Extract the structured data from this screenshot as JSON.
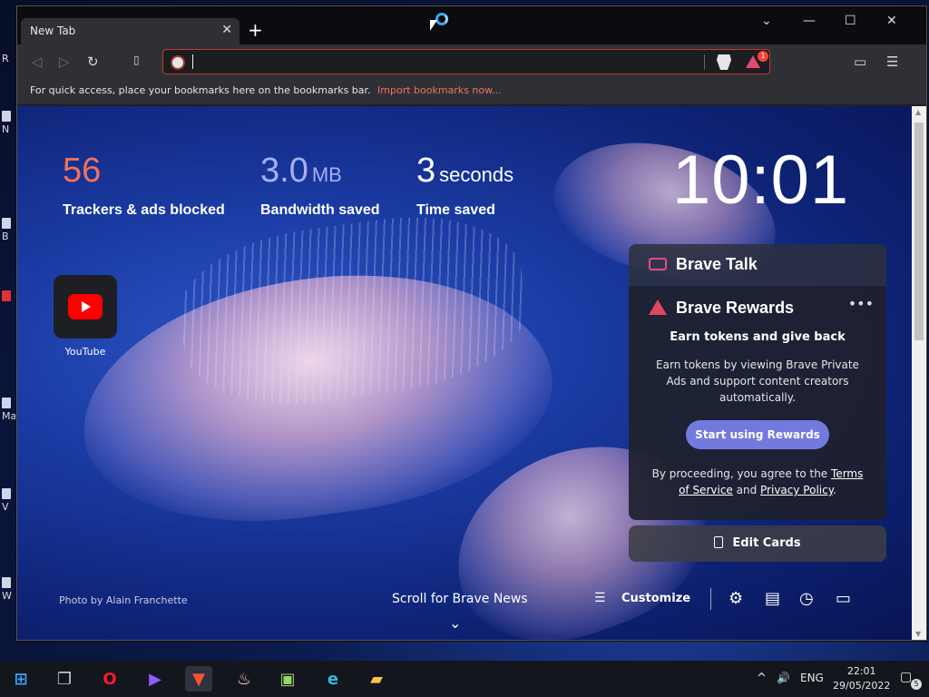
{
  "desktop": {
    "icons": [
      "R",
      "N",
      "B",
      "",
      "Ma",
      "V",
      "W"
    ]
  },
  "tab": {
    "title": "New Tab",
    "close": "✕",
    "new": "+"
  },
  "window_controls": {
    "chevron": "⌄",
    "minimize": "—",
    "maximize": "☐",
    "close": "✕"
  },
  "toolbar": {
    "back": "◁",
    "forward": "▷",
    "reload": "↻",
    "bookmark": "🔖",
    "address_value": "",
    "rewards_badge": "1",
    "wallet": "▭",
    "menu": "☰"
  },
  "bookmarks_bar": {
    "message": "For quick access, place your bookmarks here on the bookmarks bar.",
    "import_link": "Import bookmarks now..."
  },
  "stats": {
    "trackers": {
      "value": "56",
      "label": "Trackers & ads blocked",
      "color": "#f0715e"
    },
    "bandwidth": {
      "value": "3.0",
      "unit": "MB",
      "label": "Bandwidth saved",
      "color": "#a8aef5"
    },
    "time": {
      "value": "3",
      "unit": "seconds",
      "label": "Time saved",
      "color": "#ffffff"
    }
  },
  "clock": "10:01",
  "top_sites": [
    {
      "label": "YouTube",
      "icon": "youtube-icon"
    }
  ],
  "cards": {
    "talk_title": "Brave Talk",
    "rewards": {
      "title": "Brave Rewards",
      "more": "•••",
      "subtitle": "Earn tokens and give back",
      "description": "Earn tokens by viewing Brave Private Ads and support content creators automatically.",
      "button": "Start using Rewards",
      "terms_prefix": "By proceeding, you agree to the",
      "terms_link": "Terms of Service",
      "terms_and": "and",
      "privacy_link": "Privacy Policy",
      "terms_suffix": "."
    },
    "edit_cards": "Edit Cards"
  },
  "footer": {
    "photo_credit": "Photo by Alain Franchette",
    "scroll_news": "Scroll for Brave News",
    "chevron": "⌄",
    "customize": "Customize",
    "customize_icon": "☰",
    "settings_icon": "⚙",
    "bookmarks_icon": "▤",
    "history_icon": "◷",
    "talk_icon": "▭"
  },
  "taskbar": {
    "apps": [
      {
        "name": "windows-start",
        "glyph": "⊞",
        "color": "#3aa0f0"
      },
      {
        "name": "task-view",
        "glyph": "❐",
        "color": "#cfcfcf"
      },
      {
        "name": "opera",
        "glyph": "O",
        "color": "#ff1b2d"
      },
      {
        "name": "media-player",
        "glyph": "▶",
        "color": "#8b5cf6"
      },
      {
        "name": "brave",
        "glyph": "▼",
        "color": "#fb542b"
      },
      {
        "name": "popcorn",
        "glyph": "♨",
        "color": "#ffd1d1"
      },
      {
        "name": "monitor",
        "glyph": "▣",
        "color": "#9ad46a"
      },
      {
        "name": "edge",
        "glyph": "e",
        "color": "#36b6e0"
      },
      {
        "name": "file-explorer",
        "glyph": "▰",
        "color": "#f6c54a"
      }
    ],
    "tray_chevron": "^",
    "volume": "🔊",
    "language": "ENG",
    "time": "22:01",
    "date": "29/05/2022",
    "notification_count": "5"
  }
}
